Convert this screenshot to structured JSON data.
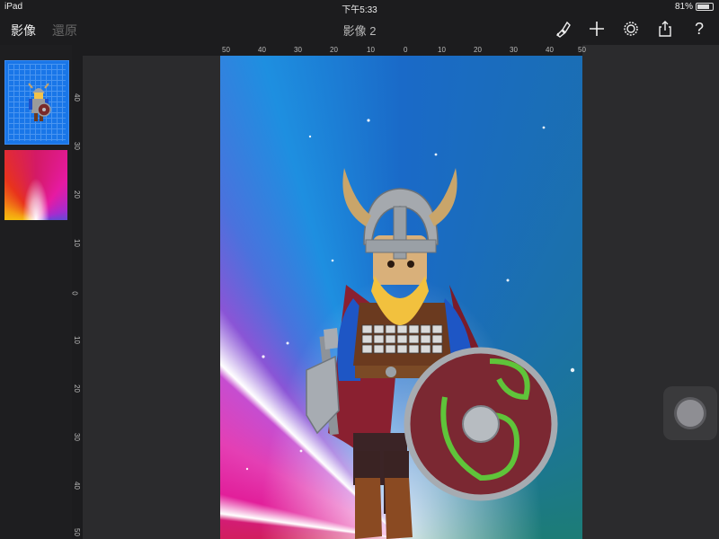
{
  "status_bar": {
    "device": "iPad",
    "time": "下午5:33",
    "battery": "81%",
    "battery_level": 0.81
  },
  "toolbar": {
    "gallery_label": "影像",
    "undo_label": "還原",
    "title": "影像 2",
    "icons": [
      "brush-icon",
      "add-icon",
      "settings-icon",
      "share-icon",
      "help-icon"
    ],
    "help_glyph": "?"
  },
  "rulers": {
    "top": [
      "50",
      "40",
      "30",
      "20",
      "10",
      "0",
      "10",
      "20",
      "30",
      "40",
      "50"
    ],
    "left": [
      "40",
      "30",
      "20",
      "10",
      "0",
      "10",
      "20",
      "30",
      "40",
      "50"
    ]
  },
  "layers": [
    {
      "name": "viking-figure-layer",
      "selected": true
    },
    {
      "name": "rainbow-burst-layer",
      "selected": false
    }
  ],
  "colors": {
    "accent": "#1976e8",
    "toolbar_bg": "#1c1c1e",
    "workspace_bg": "#2b2b2d"
  }
}
